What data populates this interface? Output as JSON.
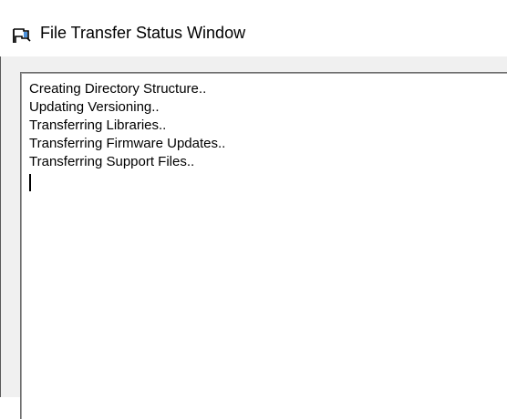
{
  "window": {
    "title": "File Transfer Status Window",
    "icon": "window-flag-icon"
  },
  "log": {
    "lines": [
      "Creating Directory Structure..",
      "Updating Versioning..",
      "Transferring Libraries..",
      "Transferring Firmware Updates..",
      "Transferring Support Files.."
    ]
  },
  "colors": {
    "client_background": "#f0f0f0",
    "log_background": "#ffffff",
    "border": "#6d6d6d"
  }
}
